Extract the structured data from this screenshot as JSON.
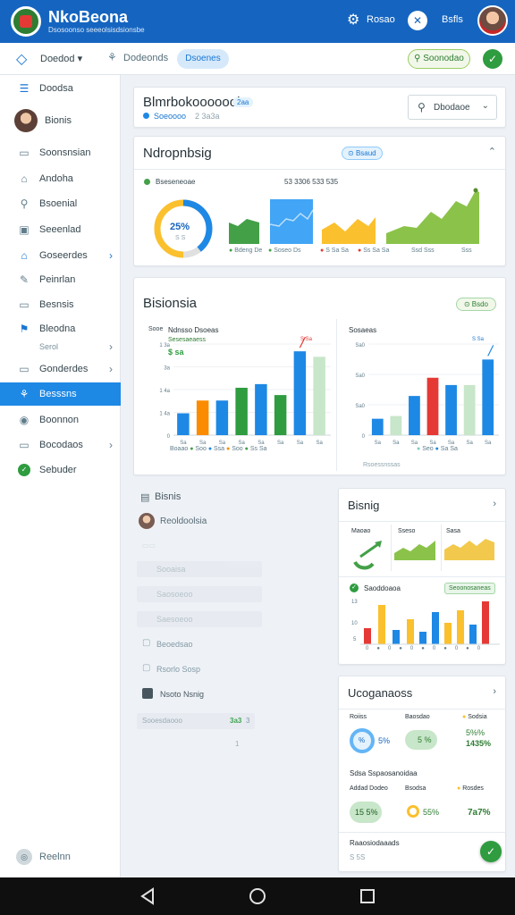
{
  "app": {
    "title": "NkoBeona",
    "subtitle": "Dsosoonso seeeolsisdsionsbe",
    "gear_label": "Rosao",
    "toggle_icon": "✕",
    "toggle_label": "Bsfls"
  },
  "toolbar": {
    "dropdown_label": "Doedod ▾",
    "tool_label": "Dodeonds",
    "tab_active": "Dsoenes",
    "green_action": "Soonodao"
  },
  "sidebar": {
    "items": [
      {
        "label": "Doodsa",
        "icon": "☰"
      },
      {
        "label": "Bionis",
        "icon": ""
      },
      {
        "label": "Soonsnsian",
        "icon": "▭"
      },
      {
        "label": "Andoha",
        "icon": "⌂"
      },
      {
        "label": "Bsoenial",
        "icon": "⚲"
      },
      {
        "label": "Seeenlad",
        "icon": "▣"
      },
      {
        "label": "Goseerdes",
        "icon": "⌂"
      },
      {
        "label": "Peinrlan",
        "icon": "▭"
      },
      {
        "label": "Besnsis",
        "icon": "▭"
      },
      {
        "label": "Bleodna",
        "icon": "⚑"
      },
      {
        "label": "Serol",
        "icon": ""
      },
      {
        "label": "Gonderdes",
        "icon": "▭"
      },
      {
        "label": "Besssns",
        "icon": "⚘"
      },
      {
        "label": "Boonnon",
        "icon": "◉"
      },
      {
        "label": "Bocodaos",
        "icon": "▭"
      },
      {
        "label": "Sebuder",
        "icon": "✓"
      }
    ],
    "bottom_label": "Reelnn"
  },
  "header_card": {
    "title": "Blmrbokooooool",
    "badge": "2aa",
    "sub_label": "Soeoooo",
    "sub_value": "2 3a3a",
    "dropdown_label": "Dbodaoe"
  },
  "overview": {
    "title": "Ndropnbsig",
    "badge": "Bsaud",
    "legend_label": "Bseseneoae",
    "stats": "53 3306   533   535",
    "donut_value": "25%",
    "donut_caption": "S S",
    "captions": [
      "Bdeng  De",
      "Soseo  Ds",
      "S Sa  Sa",
      "Ss  Sa  Sa",
      "Ssd  Sss",
      "Sss"
    ]
  },
  "bar_section": {
    "title": "Bisionsia",
    "badge": "Bsdo",
    "left": {
      "y_label": "Sooe",
      "y_top": "1 3a",
      "title": "Ndnsso Dsoeas",
      "subtitle": "Sesesaeaess",
      "value": "$ sa",
      "y_ticks": [
        "1 3a",
        "3a",
        "1 4a",
        "1 4a",
        "0"
      ],
      "x_labels": [
        "Sa",
        "Sa",
        "Sa",
        "Sa",
        "Sa",
        "Sa",
        "Sa",
        "Sa"
      ],
      "legend": [
        "Boaao",
        "Soo",
        "Ssa",
        "Soo",
        "Ss",
        "Sa"
      ],
      "callout": "S Sa"
    },
    "right": {
      "title": "Sosaeas",
      "y_ticks": [
        "Sa0",
        "Sa0",
        "Sa0",
        "0"
      ],
      "x_labels": [
        "Sa",
        "Sa",
        "Sa",
        "Sa",
        "Sa",
        "Sa",
        "Sa"
      ],
      "legend": [
        "Seo",
        "Sa",
        "Sa"
      ],
      "caption": "Rsoessnssas",
      "callout": "S Sa"
    }
  },
  "list_panel": {
    "title": "Bisnis",
    "user": "Reoldoolsia",
    "rows": [
      "Sooaisa",
      "Saosoeoo",
      "Saesoeoo",
      "Beoedsao",
      "Rsorlo Sosp",
      "Nsoto Nsnig"
    ],
    "footer_label": "Sooesdaooo",
    "footer_value": "3a3",
    "footer_value2": "3",
    "footer_sub": "1"
  },
  "mini_card": {
    "title": "Bisnig",
    "cells": [
      "Maoao",
      "Sseso",
      "Sasa"
    ],
    "legend_label": "Saoddoaoa",
    "legend_badge": "Seoonosaneas",
    "y_ticks": [
      "13",
      "10",
      "5",
      "0"
    ]
  },
  "stats_card": {
    "title": "Ucoganaoss",
    "row1_labels": [
      "Roiiss",
      "Baosdao",
      "Sodsia"
    ],
    "row1_values": [
      "%",
      "5%",
      "5 %",
      "5%%",
      "1435%"
    ],
    "section_title": "Sdsa Sspaosanoidaa",
    "row2_labels": [
      "Addad Dodeo",
      "Bsodsa",
      "Rosdes"
    ],
    "row2_values": [
      "15 5%",
      "55%",
      "7a7%"
    ],
    "footer_title": "Raaosiodaaads",
    "footer_value": "S 5S"
  },
  "colors": {
    "primary": "#1565c0",
    "accent": "#1e88e5",
    "green": "#2e9c3f",
    "orange": "#fb8c00",
    "yellow": "#fbc02d",
    "light_green": "#8bc34a",
    "red": "#e53935",
    "pale_green": "#c8e6c9"
  },
  "chart_data": [
    {
      "type": "bar",
      "categories": [
        "1",
        "2",
        "3",
        "4",
        "5",
        "6",
        "7",
        "8"
      ],
      "values": [
        24,
        38,
        38,
        52,
        56,
        44,
        92,
        86
      ],
      "ylim": [
        0,
        100
      ]
    },
    {
      "type": "bar",
      "categories": [
        "1",
        "2",
        "3",
        "4",
        "5",
        "6",
        "7"
      ],
      "values": [
        18,
        21,
        43,
        63,
        55,
        55,
        83
      ],
      "ylim": [
        0,
        100
      ]
    }
  ]
}
